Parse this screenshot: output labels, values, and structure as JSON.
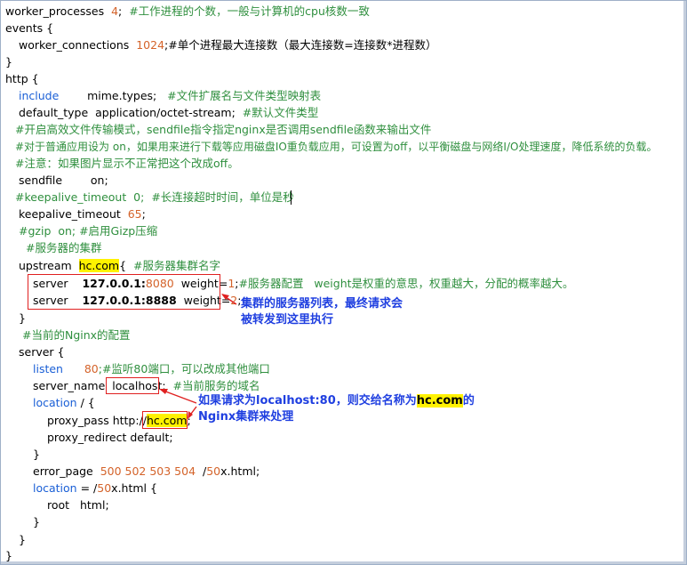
{
  "lines": {
    "l1_a": "worker_processes",
    "l1_b": "4",
    "l1_c": ";",
    "l1_d": "#工作进程的个数，一般与计算机的cpu核数一致",
    "l2": "events {",
    "l3_a": "worker_connections",
    "l3_b": "1024",
    "l3_c": ";#单个进程最大连接数（最大连接数=连接数*进程数）",
    "l4": "}",
    "l5": "http {",
    "l6_a": "include",
    "l6_b": "mime.types;",
    "l6_c": "#文件扩展名与文件类型映射表",
    "l7_a": "default_type  application/octet-stream;",
    "l7_b": "#默认文件类型",
    "l8": "#开启高效文件传输模式，sendfile指令指定nginx是否调用sendfile函数来输出文件",
    "l9": "#对于普通应用设为 on，如果用来进行下载等应用磁盘IO重负载应用，可设置为off，以平衡磁盘与网络I/O处理速度，降低系统的负载。",
    "l10": "#注意：如果图片显示不正常把这个改成off。",
    "l11": "sendfile        on;",
    "l12_a": "#keepalive_timeout  0;",
    "l12_b": "#长连接超时时间，单位是秒",
    "l13_a": "keepalive_timeout",
    "l13_b": "65",
    "l13_c": ";",
    "l14": "#gzip  on; #启用Gizp压缩",
    "l15": "#服务器的集群",
    "l16_a": "upstream",
    "l16_b": "hc.com",
    "l16_c": "{",
    "l16_d": "#服务器集群名字",
    "l17_a": "server",
    "l17_b": "127.0.0.1:",
    "l17_c": "8080",
    "l17_d": "weight=",
    "l17_e": "1",
    "l17_f": ";",
    "l17_g": "#服务器配置   weight是权重的意思，权重越大，分配的概率越大。",
    "l18_a": "server",
    "l18_b": "127.0.0.1:8888",
    "l18_c": "weight=",
    "l18_d": "2",
    "l18_e": ";",
    "l19": "}",
    "l20": "#当前的Nginx的配置",
    "l21": "server {",
    "l22_a": "listen",
    "l22_b": "80",
    "l22_c": ";#监听80端口，可以改成其他端口",
    "l23_a": "server_name",
    "l23_b": "localhost",
    "l23_c": ";",
    "l23_d": "#当前服务的域名",
    "l24_a": "location",
    "l24_b": "/ {",
    "l25_a": "proxy_pass http://",
    "l25_b": "hc.com",
    "l25_c": ";",
    "l26": "proxy_redirect default;",
    "l27": "}",
    "l28_a": "error_page",
    "l28_b": "500 502 503 504",
    "l28_c": "/",
    "l28_d": "50",
    "l28_e": "x.html;",
    "l29_a": "location",
    "l29_b": "= /",
    "l29_c": "50",
    "l29_d": "x.html {",
    "l30": "root   html;",
    "l31": "}",
    "l32": "}",
    "l33": "}"
  },
  "annotations": {
    "upstream_note_1": "集群的服务器列表，最终请求会",
    "upstream_note_2": "被转发到这里执行",
    "location_note_1_a": "如果请求为localhost:80，则交给名称为",
    "location_note_1_b": "hc.com",
    "location_note_1_c": "的",
    "location_note_2": "Nginx集群来处理"
  },
  "colors": {
    "comment": "#2f8f3e",
    "keyword": "#1a5fd6",
    "number": "#d4632a",
    "highlight": "#fff200",
    "box": "#e02020",
    "note": "#1f3fe0"
  }
}
